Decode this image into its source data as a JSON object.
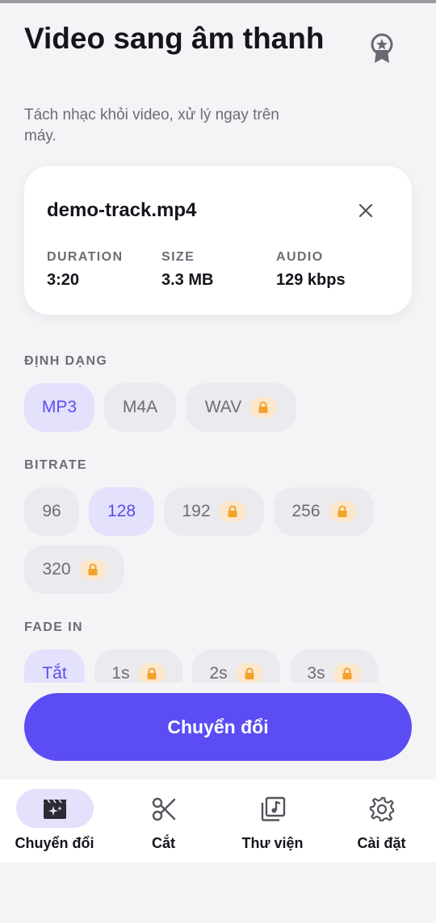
{
  "header": {
    "title": "Video sang âm thanh",
    "subtitle": "Tách nhạc khỏi video, xử lý ngay trên máy."
  },
  "file": {
    "name": "demo-track.mp4",
    "stats": [
      {
        "label": "DURATION",
        "value": "3:20"
      },
      {
        "label": "SIZE",
        "value": "3.3 MB"
      },
      {
        "label": "AUDIO",
        "value": "129 kbps"
      }
    ]
  },
  "format": {
    "label": "ĐỊNH DẠNG",
    "options": [
      {
        "label": "MP3",
        "selected": true,
        "locked": false
      },
      {
        "label": "M4A",
        "selected": false,
        "locked": false
      },
      {
        "label": "WAV",
        "selected": false,
        "locked": true
      }
    ]
  },
  "bitrate": {
    "label": "BITRATE",
    "options": [
      {
        "label": "96",
        "selected": false,
        "locked": false
      },
      {
        "label": "128",
        "selected": true,
        "locked": false
      },
      {
        "label": "192",
        "selected": false,
        "locked": true
      },
      {
        "label": "256",
        "selected": false,
        "locked": true
      },
      {
        "label": "320",
        "selected": false,
        "locked": true
      }
    ]
  },
  "fade_in": {
    "label": "FADE IN",
    "options": [
      {
        "label": "Tắt",
        "selected": true,
        "locked": false
      },
      {
        "label": "1s",
        "selected": false,
        "locked": true
      },
      {
        "label": "2s",
        "selected": false,
        "locked": true
      },
      {
        "label": "3s",
        "selected": false,
        "locked": true
      }
    ]
  },
  "convert_button": "Chuyển đổi",
  "nav": [
    {
      "label": "Chuyển đổi",
      "icon": "clapperboard-sparkle-icon",
      "active": true
    },
    {
      "label": "Cắt",
      "icon": "scissors-icon",
      "active": false
    },
    {
      "label": "Thư viện",
      "icon": "music-library-icon",
      "active": false
    },
    {
      "label": "Cài đặt",
      "icon": "gear-icon",
      "active": false
    }
  ],
  "colors": {
    "accent": "#5b4cf4",
    "accent_soft": "#e3e1fc",
    "lock_bg": "#fbe7cc",
    "lock_icon": "#f2a12b",
    "background": "#f4f3f6"
  }
}
